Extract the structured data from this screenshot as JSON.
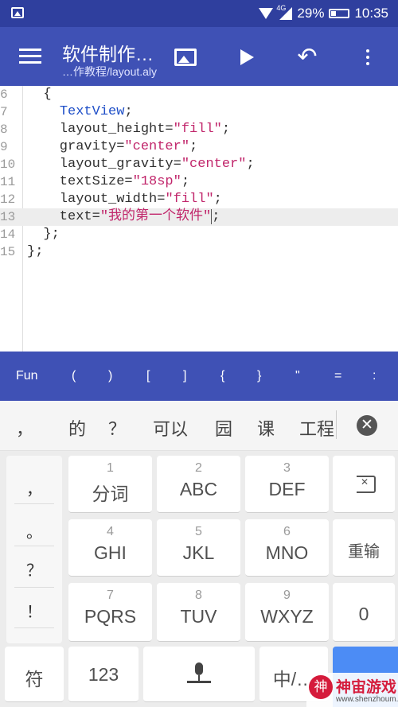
{
  "status_bar": {
    "network": "4G",
    "battery": "29%",
    "time": "10:35"
  },
  "toolbar": {
    "title": "软件制作…",
    "subtitle": "…作教程/layout.aly"
  },
  "editor": {
    "lines": [
      {
        "num": "6",
        "parts": [
          {
            "t": "  {",
            "c": "plain"
          }
        ]
      },
      {
        "num": "7",
        "parts": [
          {
            "t": "    ",
            "c": "plain"
          },
          {
            "t": "TextView",
            "c": "kw"
          },
          {
            "t": ";",
            "c": "plain"
          }
        ]
      },
      {
        "num": "8",
        "parts": [
          {
            "t": "    layout_height=",
            "c": "plain"
          },
          {
            "t": "\"fill\"",
            "c": "str"
          },
          {
            "t": ";",
            "c": "plain"
          }
        ]
      },
      {
        "num": "9",
        "parts": [
          {
            "t": "    gravity=",
            "c": "plain"
          },
          {
            "t": "\"center\"",
            "c": "str"
          },
          {
            "t": ";",
            "c": "plain"
          }
        ]
      },
      {
        "num": "10",
        "parts": [
          {
            "t": "    layout_gravity=",
            "c": "plain"
          },
          {
            "t": "\"center\"",
            "c": "str"
          },
          {
            "t": ";",
            "c": "plain"
          }
        ]
      },
      {
        "num": "11",
        "parts": [
          {
            "t": "    textSize=",
            "c": "plain"
          },
          {
            "t": "\"18sp\"",
            "c": "str"
          },
          {
            "t": ";",
            "c": "plain"
          }
        ]
      },
      {
        "num": "12",
        "parts": [
          {
            "t": "    layout_width=",
            "c": "plain"
          },
          {
            "t": "\"fill\"",
            "c": "str"
          },
          {
            "t": ";",
            "c": "plain"
          }
        ]
      },
      {
        "num": "13",
        "parts": [
          {
            "t": "    text=",
            "c": "plain"
          },
          {
            "t": "\"我的第一个软件",
            "c": "str"
          },
          {
            "t": "\"",
            "c": "str caret"
          },
          {
            "t": ";",
            "c": "plain"
          }
        ],
        "current": true
      },
      {
        "num": "14",
        "parts": [
          {
            "t": "  };",
            "c": "plain"
          }
        ]
      },
      {
        "num": "15",
        "parts": [
          {
            "t": "};",
            "c": "plain"
          }
        ]
      }
    ]
  },
  "symbols": [
    "Fun",
    "(",
    ")",
    "[",
    "]",
    "{",
    "}",
    "\"",
    "=",
    ":"
  ],
  "candidates": [
    "，",
    "的",
    "？",
    "可以",
    "园",
    "课",
    "工程"
  ],
  "keyboard": {
    "punctuation": [
      "，",
      "。",
      "？",
      "！"
    ],
    "keys": [
      {
        "num": "1",
        "label": "分词"
      },
      {
        "num": "2",
        "label": "ABC"
      },
      {
        "num": "3",
        "label": "DEF"
      },
      {
        "num": "4",
        "label": "GHI"
      },
      {
        "num": "5",
        "label": "JKL"
      },
      {
        "num": "6",
        "label": "MNO"
      },
      {
        "num": "7",
        "label": "PQRS"
      },
      {
        "num": "8",
        "label": "TUV"
      },
      {
        "num": "9",
        "label": "WXYZ"
      }
    ],
    "side": {
      "reenter": "重输",
      "zero": "0"
    },
    "bottom": {
      "symbols": "符",
      "numbers": "123",
      "lang": "中/…"
    }
  },
  "watermark": {
    "title": "神宙游戏",
    "url": "www.shenzhoum.com",
    "logo": "神"
  }
}
